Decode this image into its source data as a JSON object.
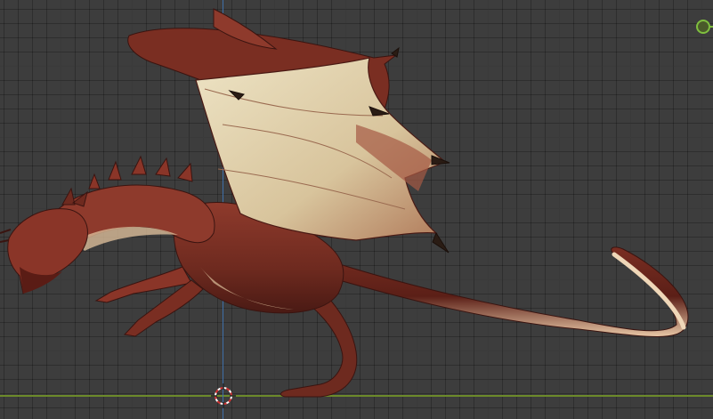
{
  "viewport": {
    "grid_visible": true,
    "background_color": "#3d3d3d",
    "x_axis_color": "#6c8a2a",
    "z_axis_color": "#3f6fa8"
  },
  "objects": {
    "model": {
      "icon": "dragon-model"
    },
    "cursor": {
      "icon": "3d-cursor-icon"
    },
    "light": {
      "icon": "light-handle-icon",
      "color": "#7fbf3f"
    }
  }
}
